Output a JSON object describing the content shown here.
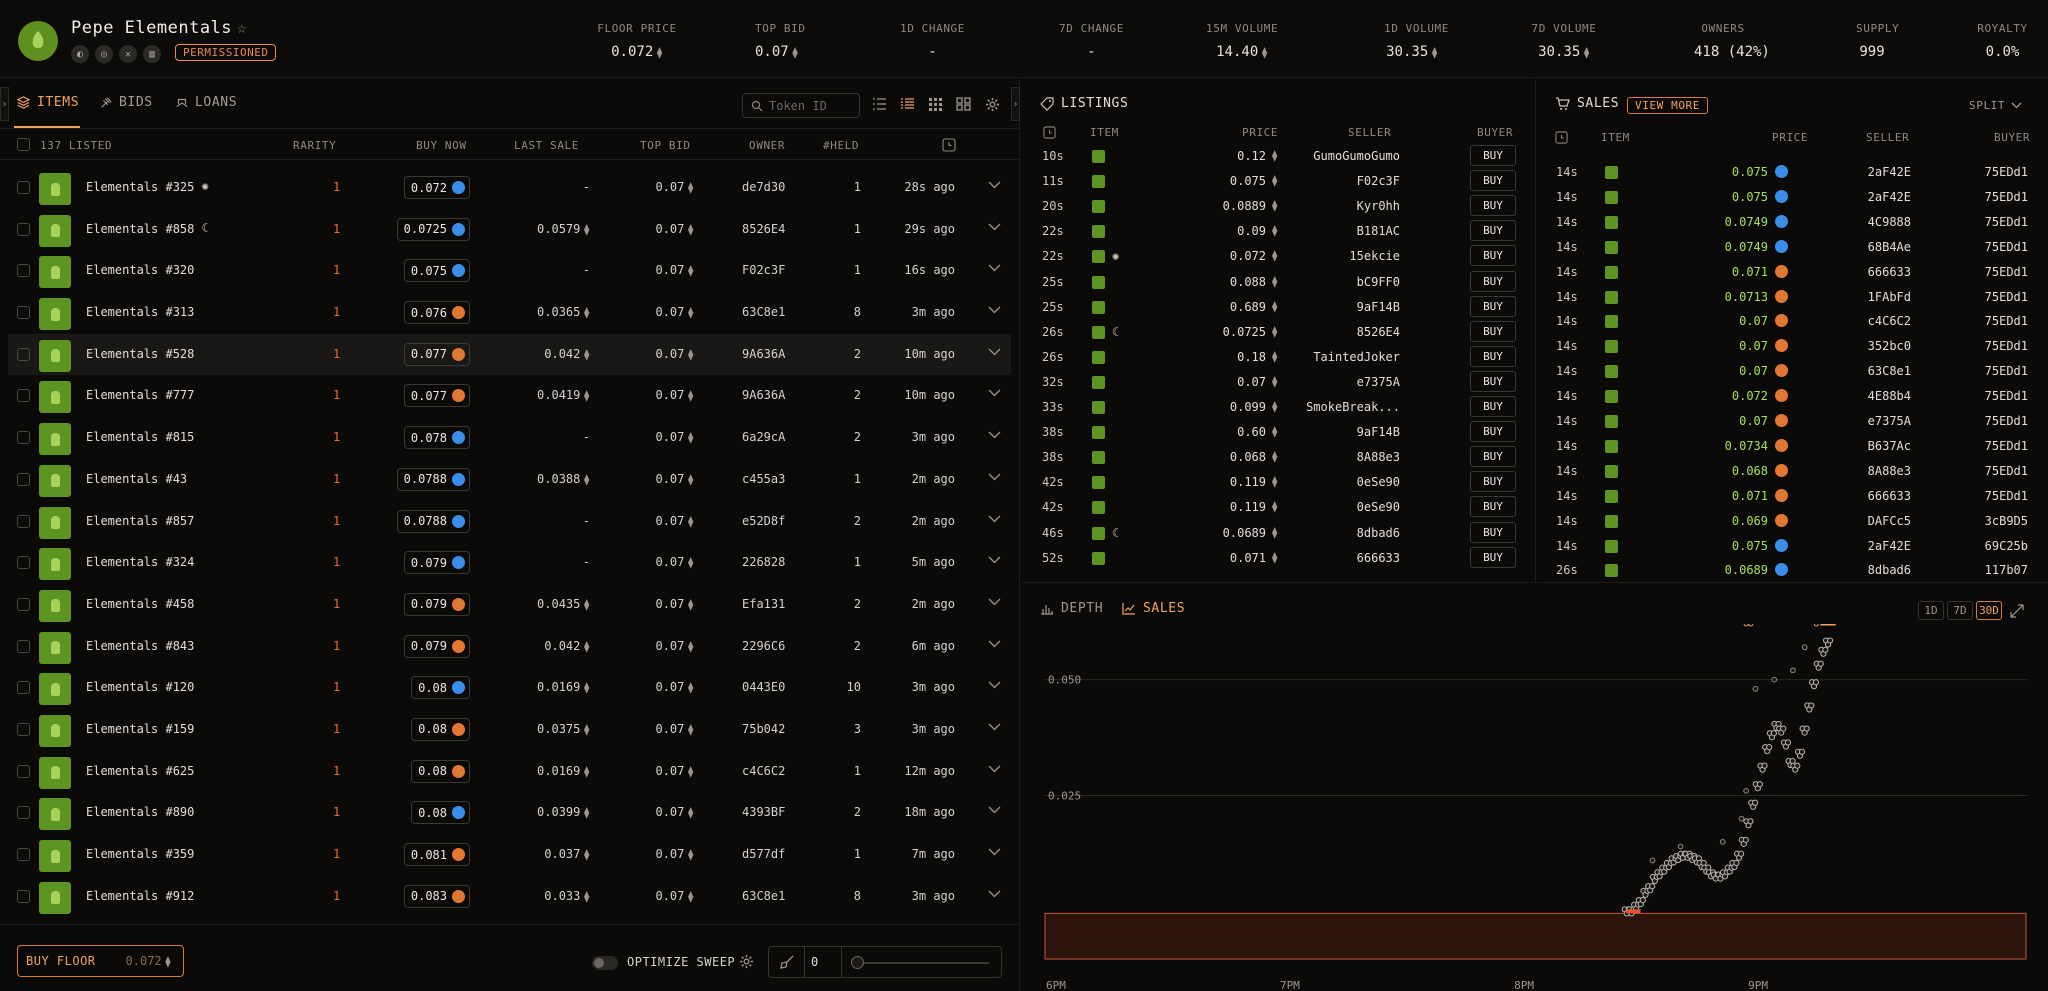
{
  "collection": {
    "name": "Pepe Elementals",
    "badge": "PERMISSIONED"
  },
  "stats": [
    {
      "label": "FLOOR PRICE",
      "value": "0.072",
      "eth": true
    },
    {
      "label": "TOP BID",
      "value": "0.07",
      "eth": true
    },
    {
      "label": "1D CHANGE",
      "value": "-",
      "eth": false
    },
    {
      "label": "7D CHANGE",
      "value": "-",
      "eth": false
    },
    {
      "label": "15M VOLUME",
      "value": "14.40",
      "eth": true
    },
    {
      "label": "1D VOLUME",
      "value": "30.35",
      "eth": true
    },
    {
      "label": "7D VOLUME",
      "value": "30.35",
      "eth": true
    },
    {
      "label": "OWNERS",
      "value": "418 (42%)",
      "eth": false
    },
    {
      "label": "SUPPLY",
      "value": "999",
      "eth": false
    },
    {
      "label": "ROYALTY",
      "value": "0.0%",
      "eth": false
    }
  ],
  "tabs": {
    "items": "ITEMS",
    "bids": "BIDS",
    "loans": "LOANS"
  },
  "token_search": {
    "placeholder": "Token ID"
  },
  "items_header": {
    "listed": "137 LISTED",
    "rarity": "RARITY",
    "buy_now": "BUY NOW",
    "last_sale": "LAST SALE",
    "top_bid": "TOP BID",
    "owner": "OWNER",
    "held": "#HELD"
  },
  "items": [
    {
      "name": "Elementals #325",
      "rarity": "1",
      "buy": "0.072",
      "mk": "b",
      "last": "-",
      "top": "0.07",
      "owner": "de7d30",
      "held": "1",
      "time": "28s ago",
      "tag": "spin"
    },
    {
      "name": "Elementals #858",
      "rarity": "1",
      "buy": "0.0725",
      "mk": "b",
      "last": "0.0579",
      "top": "0.07",
      "owner": "8526E4",
      "held": "1",
      "time": "29s ago",
      "tag": "moon"
    },
    {
      "name": "Elementals #320",
      "rarity": "1",
      "buy": "0.075",
      "mk": "b",
      "last": "-",
      "top": "0.07",
      "owner": "F02c3F",
      "held": "1",
      "time": "16s ago",
      "tag": ""
    },
    {
      "name": "Elementals #313",
      "rarity": "1",
      "buy": "0.076",
      "mk": "o",
      "last": "0.0365",
      "top": "0.07",
      "owner": "63C8e1",
      "held": "8",
      "time": "3m ago",
      "tag": ""
    },
    {
      "name": "Elementals #528",
      "rarity": "1",
      "buy": "0.077",
      "mk": "o",
      "last": "0.042",
      "top": "0.07",
      "owner": "9A636A",
      "held": "2",
      "time": "10m ago",
      "tag": ""
    },
    {
      "name": "Elementals #777",
      "rarity": "1",
      "buy": "0.077",
      "mk": "o",
      "last": "0.0419",
      "top": "0.07",
      "owner": "9A636A",
      "held": "2",
      "time": "10m ago",
      "tag": ""
    },
    {
      "name": "Elementals #815",
      "rarity": "1",
      "buy": "0.078",
      "mk": "b",
      "last": "-",
      "top": "0.07",
      "owner": "6a29cA",
      "held": "2",
      "time": "3m ago",
      "tag": ""
    },
    {
      "name": "Elementals #43",
      "rarity": "1",
      "buy": "0.0788",
      "mk": "b",
      "last": "0.0388",
      "top": "0.07",
      "owner": "c455a3",
      "held": "1",
      "time": "2m ago",
      "tag": ""
    },
    {
      "name": "Elementals #857",
      "rarity": "1",
      "buy": "0.0788",
      "mk": "b",
      "last": "-",
      "top": "0.07",
      "owner": "e52D8f",
      "held": "2",
      "time": "2m ago",
      "tag": ""
    },
    {
      "name": "Elementals #324",
      "rarity": "1",
      "buy": "0.079",
      "mk": "b",
      "last": "-",
      "top": "0.07",
      "owner": "226828",
      "held": "1",
      "time": "5m ago",
      "tag": ""
    },
    {
      "name": "Elementals #458",
      "rarity": "1",
      "buy": "0.079",
      "mk": "o",
      "last": "0.0435",
      "top": "0.07",
      "owner": "Efa131",
      "held": "2",
      "time": "2m ago",
      "tag": ""
    },
    {
      "name": "Elementals #843",
      "rarity": "1",
      "buy": "0.079",
      "mk": "o",
      "last": "0.042",
      "top": "0.07",
      "owner": "2296C6",
      "held": "2",
      "time": "6m ago",
      "tag": ""
    },
    {
      "name": "Elementals #120",
      "rarity": "1",
      "buy": "0.08",
      "mk": "b",
      "last": "0.0169",
      "top": "0.07",
      "owner": "0443E0",
      "held": "10",
      "time": "3m ago",
      "tag": ""
    },
    {
      "name": "Elementals #159",
      "rarity": "1",
      "buy": "0.08",
      "mk": "o",
      "last": "0.0375",
      "top": "0.07",
      "owner": "75b042",
      "held": "3",
      "time": "3m ago",
      "tag": ""
    },
    {
      "name": "Elementals #625",
      "rarity": "1",
      "buy": "0.08",
      "mk": "o",
      "last": "0.0169",
      "top": "0.07",
      "owner": "c4C6C2",
      "held": "1",
      "time": "12m ago",
      "tag": ""
    },
    {
      "name": "Elementals #890",
      "rarity": "1",
      "buy": "0.08",
      "mk": "b",
      "last": "0.0399",
      "top": "0.07",
      "owner": "4393BF",
      "held": "2",
      "time": "18m ago",
      "tag": ""
    },
    {
      "name": "Elementals #359",
      "rarity": "1",
      "buy": "0.081",
      "mk": "o",
      "last": "0.037",
      "top": "0.07",
      "owner": "d577df",
      "held": "1",
      "time": "7m ago",
      "tag": ""
    },
    {
      "name": "Elementals #912",
      "rarity": "1",
      "buy": "0.083",
      "mk": "o",
      "last": "0.033",
      "top": "0.07",
      "owner": "63C8e1",
      "held": "8",
      "time": "3m ago",
      "tag": ""
    }
  ],
  "footer": {
    "buy_floor": "BUY FLOOR",
    "floor_value": "0.072",
    "optimize": "OPTIMIZE SWEEP",
    "sweep_count": "0"
  },
  "listings": {
    "title": "LISTINGS",
    "headers": {
      "item": "ITEM",
      "price": "PRICE",
      "seller": "SELLER",
      "buyer": "BUYER"
    },
    "buy_label": "BUY",
    "rows": [
      {
        "t": "10s",
        "price": "0.12",
        "seller": "GumoGumoGumo",
        "tag": ""
      },
      {
        "t": "11s",
        "price": "0.075",
        "seller": "F02c3F",
        "tag": ""
      },
      {
        "t": "20s",
        "price": "0.0889",
        "seller": "Kyr0hh",
        "tag": ""
      },
      {
        "t": "22s",
        "price": "0.09",
        "seller": "B181AC",
        "tag": ""
      },
      {
        "t": "22s",
        "price": "0.072",
        "seller": "15ekcie",
        "tag": "spin"
      },
      {
        "t": "25s",
        "price": "0.088",
        "seller": "bC9FF0",
        "tag": ""
      },
      {
        "t": "25s",
        "price": "0.689",
        "seller": "9aF14B",
        "tag": ""
      },
      {
        "t": "26s",
        "price": "0.0725",
        "seller": "8526E4",
        "tag": "moon"
      },
      {
        "t": "26s",
        "price": "0.18",
        "seller": "TaintedJoker",
        "tag": ""
      },
      {
        "t": "32s",
        "price": "0.07",
        "seller": "e7375A",
        "tag": ""
      },
      {
        "t": "33s",
        "price": "0.099",
        "seller": "SmokeBreak...",
        "tag": ""
      },
      {
        "t": "38s",
        "price": "0.60",
        "seller": "9aF14B",
        "tag": ""
      },
      {
        "t": "38s",
        "price": "0.068",
        "seller": "8A88e3",
        "tag": ""
      },
      {
        "t": "42s",
        "price": "0.119",
        "seller": "0eSe90",
        "tag": ""
      },
      {
        "t": "42s",
        "price": "0.119",
        "seller": "0eSe90",
        "tag": ""
      },
      {
        "t": "46s",
        "price": "0.0689",
        "seller": "8dbad6",
        "tag": "moon"
      },
      {
        "t": "52s",
        "price": "0.071",
        "seller": "666633",
        "tag": ""
      }
    ]
  },
  "sales": {
    "title": "SALES",
    "view_more": "VIEW MORE",
    "split": "SPLIT",
    "headers": {
      "item": "ITEM",
      "price": "PRICE",
      "seller": "SELLER",
      "buyer": "BUYER"
    },
    "rows": [
      {
        "t": "14s",
        "price": "0.075",
        "mk": "b",
        "seller": "2aF42E",
        "buyer": "75EDd1"
      },
      {
        "t": "14s",
        "price": "0.075",
        "mk": "b",
        "seller": "2aF42E",
        "buyer": "75EDd1"
      },
      {
        "t": "14s",
        "price": "0.0749",
        "mk": "b",
        "seller": "4C9888",
        "buyer": "75EDd1"
      },
      {
        "t": "14s",
        "price": "0.0749",
        "mk": "b",
        "seller": "68B4Ae",
        "buyer": "75EDd1"
      },
      {
        "t": "14s",
        "price": "0.071",
        "mk": "o",
        "seller": "666633",
        "buyer": "75EDd1"
      },
      {
        "t": "14s",
        "price": "0.0713",
        "mk": "o",
        "seller": "1FAbFd",
        "buyer": "75EDd1"
      },
      {
        "t": "14s",
        "price": "0.07",
        "mk": "o",
        "seller": "c4C6C2",
        "buyer": "75EDd1"
      },
      {
        "t": "14s",
        "price": "0.07",
        "mk": "o",
        "seller": "352bc0",
        "buyer": "75EDd1"
      },
      {
        "t": "14s",
        "price": "0.07",
        "mk": "o",
        "seller": "63C8e1",
        "buyer": "75EDd1"
      },
      {
        "t": "14s",
        "price": "0.072",
        "mk": "o",
        "seller": "4E88b4",
        "buyer": "75EDd1"
      },
      {
        "t": "14s",
        "price": "0.07",
        "mk": "o",
        "seller": "e7375A",
        "buyer": "75EDd1"
      },
      {
        "t": "14s",
        "price": "0.0734",
        "mk": "o",
        "seller": "B637Ac",
        "buyer": "75EDd1"
      },
      {
        "t": "14s",
        "price": "0.068",
        "mk": "o",
        "seller": "8A88e3",
        "buyer": "75EDd1"
      },
      {
        "t": "14s",
        "price": "0.071",
        "mk": "o",
        "seller": "666633",
        "buyer": "75EDd1"
      },
      {
        "t": "14s",
        "price": "0.069",
        "mk": "o",
        "seller": "DAFCc5",
        "buyer": "3cB9D5"
      },
      {
        "t": "14s",
        "price": "0.075",
        "mk": "b",
        "seller": "2aF42E",
        "buyer": "69C25b"
      },
      {
        "t": "26s",
        "price": "0.0689",
        "mk": "b",
        "seller": "8dbad6",
        "buyer": "117b07"
      }
    ]
  },
  "chart_tabs": {
    "depth": "DEPTH",
    "sales": "SALES"
  },
  "ranges": [
    "1D",
    "7D",
    "30D"
  ],
  "active_range": "30D",
  "chart_data": {
    "type": "scatter",
    "title": "",
    "xlabel": "",
    "ylabel": "",
    "x_ticks": [
      "6PM",
      "7PM",
      "8PM",
      "9PM"
    ],
    "y_ticks": [
      0.025,
      0.05
    ],
    "xlim": [
      0,
      4.2
    ],
    "ylim": [
      -0.012,
      0.062
    ],
    "grid": true,
    "series": [
      {
        "points": [
          [
            2.49,
            0.0
          ],
          [
            2.51,
            0.0
          ],
          [
            2.53,
            0.001
          ],
          [
            2.55,
            0.002
          ],
          [
            2.57,
            0.004
          ],
          [
            2.59,
            0.005
          ],
          [
            2.61,
            0.007
          ],
          [
            2.63,
            0.008
          ],
          [
            2.65,
            0.009
          ],
          [
            2.67,
            0.01
          ],
          [
            2.69,
            0.011
          ],
          [
            2.71,
            0.0115
          ],
          [
            2.73,
            0.012
          ],
          [
            2.75,
            0.012
          ],
          [
            2.77,
            0.0115
          ],
          [
            2.79,
            0.011
          ],
          [
            2.81,
            0.01
          ],
          [
            2.83,
            0.009
          ],
          [
            2.85,
            0.008
          ],
          [
            2.87,
            0.0075
          ],
          [
            2.89,
            0.0075
          ],
          [
            2.91,
            0.008
          ],
          [
            2.93,
            0.009
          ],
          [
            2.95,
            0.01
          ],
          [
            2.97,
            0.012
          ],
          [
            2.99,
            0.015
          ],
          [
            3.01,
            0.019
          ],
          [
            3.03,
            0.023
          ],
          [
            3.05,
            0.027
          ],
          [
            3.07,
            0.031
          ],
          [
            3.09,
            0.035
          ],
          [
            3.11,
            0.038
          ],
          [
            3.13,
            0.04
          ],
          [
            3.15,
            0.039
          ],
          [
            3.17,
            0.036
          ],
          [
            3.19,
            0.032
          ],
          [
            3.21,
            0.031
          ],
          [
            3.23,
            0.034
          ],
          [
            3.25,
            0.039
          ],
          [
            3.27,
            0.044
          ],
          [
            3.29,
            0.049
          ],
          [
            3.31,
            0.053
          ],
          [
            3.33,
            0.056
          ],
          [
            3.35,
            0.058
          ]
        ]
      },
      {
        "points": [
          [
            3.04,
            0.048
          ],
          [
            3.12,
            0.05
          ],
          [
            3.2,
            0.052
          ],
          [
            3.25,
            0.057
          ],
          [
            2.9,
            0.015
          ],
          [
            2.98,
            0.02
          ],
          [
            3.0,
            0.026
          ],
          [
            2.6,
            0.011
          ],
          [
            2.72,
            0.014
          ]
        ]
      },
      {
        "points": [
          [
            2.5,
            0.0
          ],
          [
            2.52,
            0.0
          ],
          [
            2.54,
            0.0
          ]
        ]
      },
      {
        "points": [
          [
            3.0,
            0.062
          ],
          [
            3.02,
            0.062
          ],
          [
            3.3,
            0.062
          ],
          [
            3.33,
            0.062
          ],
          [
            3.35,
            0.062
          ],
          [
            3.37,
            0.062
          ]
        ]
      }
    ],
    "colors": {
      "sales": "#b9b5ae",
      "dot_ring": "#8a8780",
      "low": "#e8552f",
      "listing": "#f0a35e",
      "band_fill": "#2b130c",
      "band_border": "#c8563a"
    }
  }
}
